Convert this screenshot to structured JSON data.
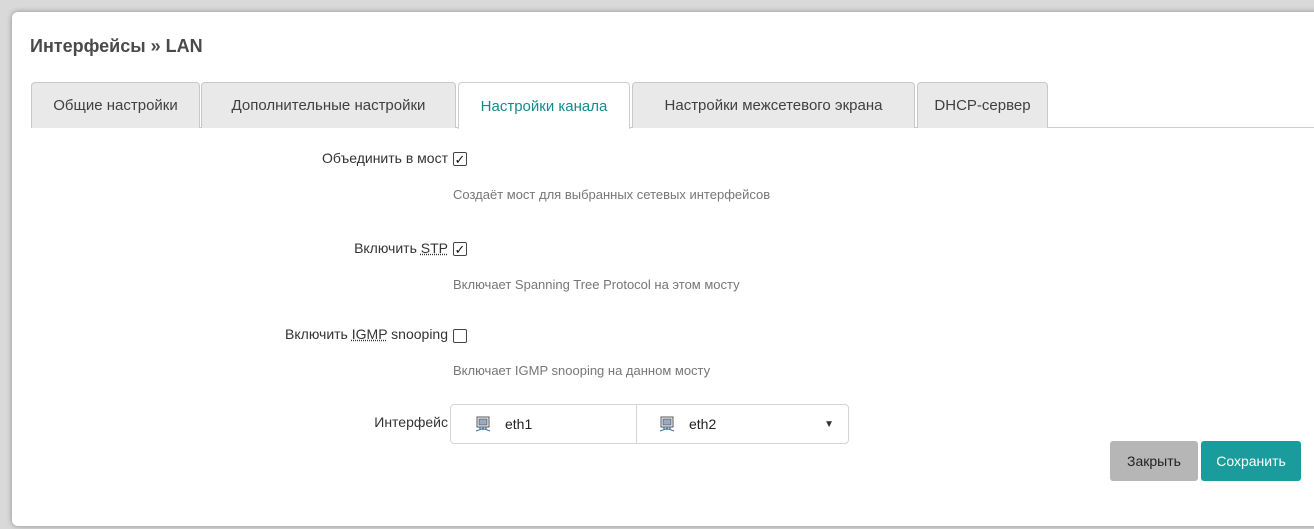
{
  "title": "Интерфейсы » LAN",
  "tabs": [
    {
      "label": "Общие настройки"
    },
    {
      "label": "Дополнительные настройки"
    },
    {
      "label": "Настройки канала"
    },
    {
      "label": "Настройки межсетевого экрана"
    },
    {
      "label": "DHCP-сервер"
    }
  ],
  "active_tab": "Настройки канала",
  "fields": {
    "bridge": {
      "label": "Объединить в мост",
      "checked": true,
      "description": "Создаёт мост для выбранных сетевых интерфейсов"
    },
    "stp": {
      "label_prefix": "Включить",
      "label_abbr": "STP",
      "checked": true,
      "description": "Включает Spanning Tree Protocol на этом мосту"
    },
    "igmp": {
      "label_prefix": "Включить",
      "label_abbr": "IGMP",
      "label_suffix": "snooping",
      "checked": false,
      "description": "Включает IGMP snooping на данном мосту"
    },
    "interface": {
      "label": "Интерфейс",
      "selected": [
        "eth1",
        "eth2"
      ],
      "icon": "network-port-icon"
    }
  },
  "buttons": {
    "close": "Закрыть",
    "save": "Сохранить"
  },
  "colors": {
    "accent": "#1a9c9c",
    "tab_active_text": "#158a8e",
    "close_button": "#b6b6b6"
  }
}
